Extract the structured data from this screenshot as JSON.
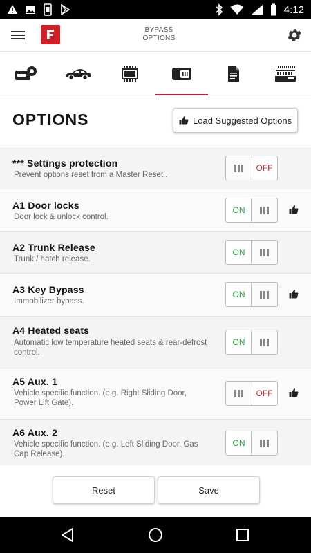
{
  "status_bar": {
    "time": "4:12",
    "left_icons": [
      "warning-icon",
      "image-icon",
      "phone-icon",
      "play-store-icon"
    ],
    "right_icons": [
      "bluetooth-icon",
      "wifi-icon",
      "signal-icon",
      "battery-icon"
    ]
  },
  "header": {
    "title_line1": "BYPASS",
    "title_line2": "OPTIONS",
    "logo_letter": "F"
  },
  "tabs": [
    {
      "name": "module",
      "icon": "module-settings-icon"
    },
    {
      "name": "vehicle",
      "icon": "car-icon"
    },
    {
      "name": "firmware",
      "icon": "chip-icon"
    },
    {
      "name": "options",
      "icon": "switch-icon",
      "selected": true
    },
    {
      "name": "notes",
      "icon": "document-icon"
    },
    {
      "name": "remote",
      "icon": "remote-icon"
    }
  ],
  "options": {
    "title": "OPTIONS",
    "suggest_label": "Load Suggested Options",
    "items": [
      {
        "title": "*** Settings protection",
        "desc": "Prevent options reset from a Master Reset..",
        "state": "OFF",
        "suggested": false
      },
      {
        "title": "A1 Door locks",
        "desc": "Door lock & unlock control.",
        "state": "ON",
        "suggested": true
      },
      {
        "title": "A2 Trunk Release",
        "desc": "Trunk / hatch release.",
        "state": "ON",
        "suggested": false
      },
      {
        "title": "A3 Key Bypass",
        "desc": "Immobilizer bypass.",
        "state": "ON",
        "suggested": true
      },
      {
        "title": "A4 Heated seats",
        "desc": "Automatic low temperature heated seats & rear-defrost control.",
        "state": "ON",
        "suggested": false
      },
      {
        "title": "A5 Aux. 1",
        "desc": "Vehicle specific function. (e.g. Right Sliding Door, Power Lift Gate).",
        "state": "OFF",
        "suggested": true
      },
      {
        "title": "A6 Aux. 2",
        "desc": "Vehicle specific function. (e.g. Left Sliding Door, Gas Cap Release).",
        "state": "ON",
        "suggested": false
      }
    ]
  },
  "buttons": {
    "reset": "Reset",
    "save": "Save"
  },
  "colors": {
    "accent": "#c21f2b",
    "on": "#2e9b3c",
    "off": "#c0323a"
  }
}
